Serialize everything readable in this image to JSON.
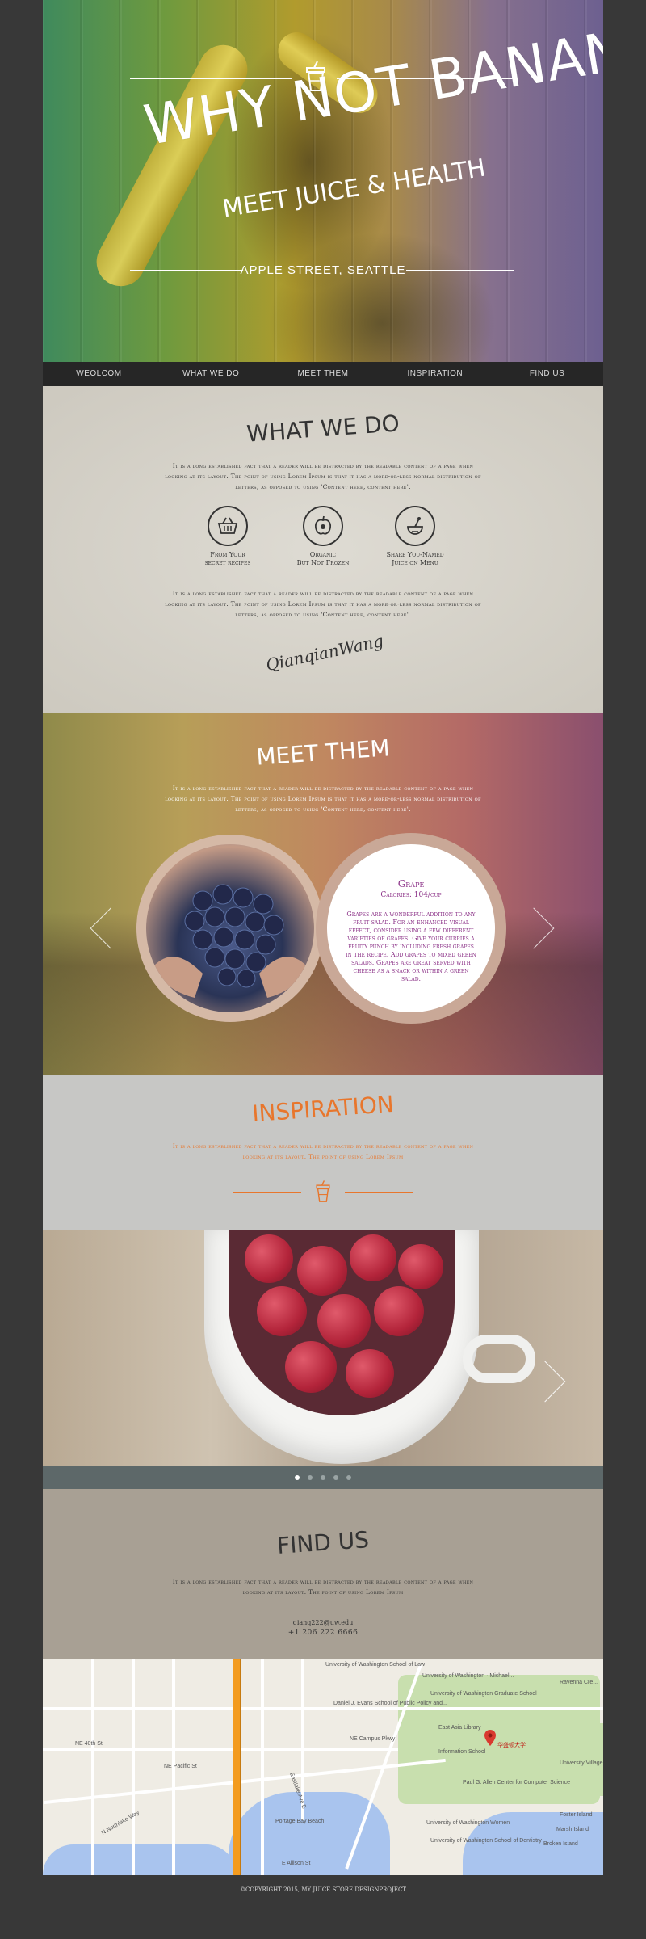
{
  "hero": {
    "title": "WHY NOT BANANA",
    "subtitle": "MEET JUICE & HEALTH",
    "address": "APPLE STREET, SEATTLE"
  },
  "nav": {
    "items": [
      {
        "label": "WEOLCOM"
      },
      {
        "label": "WHAT WE DO"
      },
      {
        "label": "MEET THEM"
      },
      {
        "label": "INSPIRATION"
      },
      {
        "label": "FIND US"
      }
    ]
  },
  "what_we_do": {
    "title": "WHAT WE DO",
    "intro": "It is a long established fact that a reader will be distracted by the readable content of a page when looking at its layout. The point of using Lorem Ipsum is that it has a more-or-less normal distribution of letters, as opposed to using 'Content here, content here'.",
    "features": [
      {
        "icon": "basket-icon",
        "line1": "From Your",
        "line2": "secret recipes"
      },
      {
        "icon": "apple-icon",
        "line1": "Organic",
        "line2": "But Not Frozen"
      },
      {
        "icon": "share-icon",
        "line1": "Share You-Named",
        "line2": "Juice on Menu"
      }
    ],
    "outro": "It is a long established fact that a reader will be distracted by the readable content of a page when looking at its layout. The point of using Lorem Ipsum is that it has a more-or-less normal distribution of letters, as opposed to using 'Content here, content here'.",
    "signature": "QianqianWang"
  },
  "meet_them": {
    "title": "MEET THEM",
    "intro": "It is a long established fact that a reader will be distracted by the readable content of a page when looking at its layout. The point of using Lorem Ipsum is that it has a more-or-less normal distribution of letters, as opposed to using 'Content here, content here'.",
    "fruit": {
      "name": "Grape",
      "calories": "Calories: 104/cup",
      "description": "Grapes are a wonderful addition to any fruit salad. For an enhanced visual effect, consider using a few different varieties of grapes. Give your curries a fruity punch by including fresh grapes in the recipe. Add grapes to mixed green salads. Grapes are great served with cheese as a snack or within a green salad."
    }
  },
  "inspiration": {
    "title": "INSPIRATION",
    "intro": "It is a long established fact that a reader will be distracted by the readable content of a page when looking at its layout. The point of using Lorem Ipsum",
    "slide_count": 5,
    "active_slide": 1
  },
  "find_us": {
    "title": "FIND US",
    "intro": "It is a long established fact that a reader will be distracted by the readable content of a page when looking at its layout. The point of using Lorem Ipsum",
    "email": "qianq222@uw.edu",
    "phone": "+1 206 222 6666"
  },
  "map": {
    "labels": {
      "law": "University of Washington School of Law",
      "michael": "University of Washington · Michael...",
      "graduate": "University of Washington Graduate School",
      "evans": "Daniel J. Evans School of Public Policy and...",
      "east_asia": "East Asia Library",
      "info_school": "Information School",
      "allen": "Paul G. Allen Center for Computer Science",
      "women": "University of Washington Women",
      "dentistry": "University of Washington School of Dentistry",
      "pin": "华盛顿大学",
      "portage": "Portage Bay Beach",
      "foster": "Foster Island",
      "marsh": "Marsh Island",
      "broken": "Broken Island",
      "village": "University Village",
      "ravenna": "Ravenna Cre...",
      "ne_campus": "NE Campus Pkwy",
      "ne40": "NE 40th St",
      "pacific": "NE Pacific St",
      "nw_northlake": "N Northlake Way",
      "eastlake": "Eastlake Ave E",
      "allison": "E Allison St"
    }
  },
  "footer": {
    "text": "©COPYRIGHT 2015, MY JUICE STORE DESIGNPROJECT"
  },
  "colors": {
    "inspiration_accent": "#e8762c",
    "grape_accent": "#8a2f86",
    "background": "#383838"
  }
}
